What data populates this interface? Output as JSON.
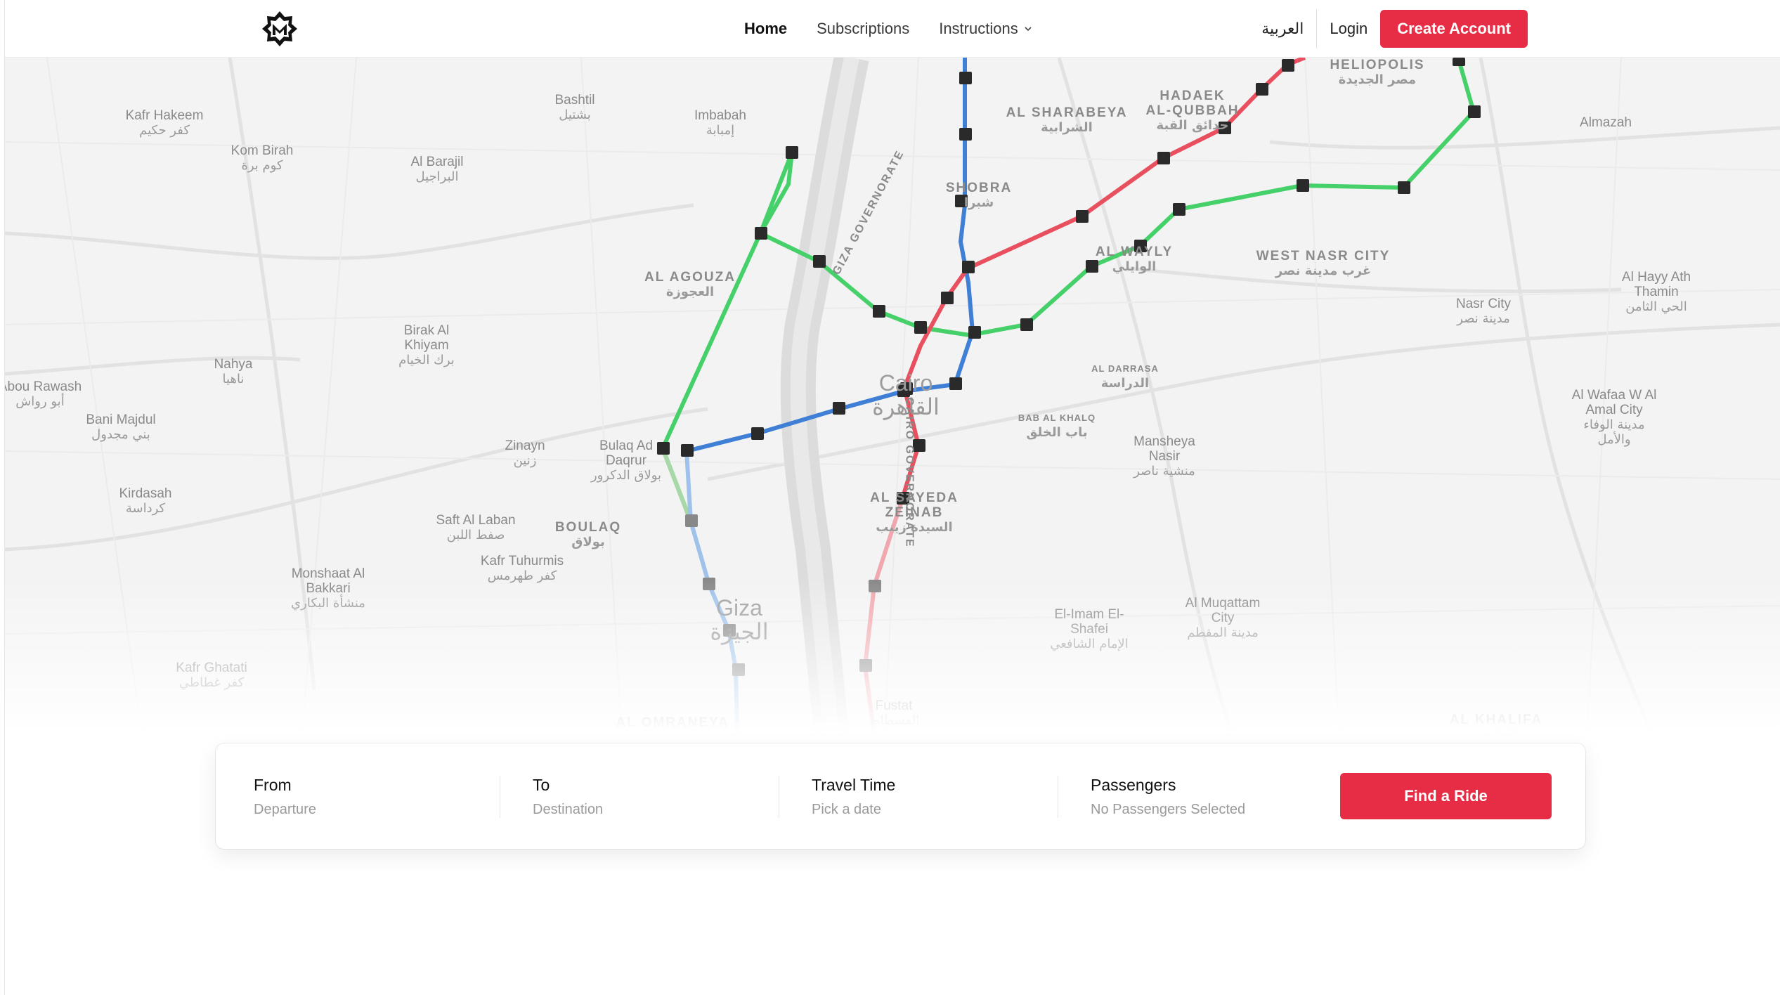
{
  "nav": {
    "links": [
      {
        "label": "Home"
      },
      {
        "label": "Subscriptions"
      },
      {
        "label": "Instructions"
      }
    ],
    "language": "العربية",
    "login": "Login",
    "create_account": "Create Account"
  },
  "map": {
    "places": [
      {
        "en": "Kafr Hakeem",
        "ar": "كفر حكيم"
      },
      {
        "en": "Kom Birah",
        "ar": "كوم برة"
      },
      {
        "en": "Bashtil",
        "ar": "بشتيل"
      },
      {
        "en": "Imbabah",
        "ar": "إمبابة"
      },
      {
        "en": "Al Barajil",
        "ar": "البراجيل"
      },
      {
        "en": "AL SHARABEYA",
        "ar": "الشرابية"
      },
      {
        "en": "HADAEK",
        "ar": ""
      },
      {
        "en": "AL-QUBBAH",
        "ar": "حدائق القبة"
      },
      {
        "en": "HELIOPOLIS",
        "ar": "مصر الجديدة"
      },
      {
        "en": "Almazah",
        "ar": ""
      },
      {
        "en": "SHOBRA",
        "ar": "شبرا"
      },
      {
        "en": "AL AGOUZA",
        "ar": "العجوزة"
      },
      {
        "en": "AL WAYLY",
        "ar": "الوايلي"
      },
      {
        "en": "WEST NASR CITY",
        "ar": "غرب مدينة نصر"
      },
      {
        "en": "Nasr City",
        "ar": "مدينة نصر"
      },
      {
        "en": "Al Hayy Ath Thamin",
        "ar": "الحي الثامن"
      },
      {
        "en": "Birak Al Khiyam",
        "ar": "برك الخيام"
      },
      {
        "en": "Nahya",
        "ar": "ناهيا"
      },
      {
        "en": "Abou Rawash",
        "ar": "أبو رواش"
      },
      {
        "en": "Bani Majdul",
        "ar": "بني مجدول"
      },
      {
        "en": "Cairo",
        "ar": "القاهرة"
      },
      {
        "en": "AL DARRASA",
        "ar": "الدراسة"
      },
      {
        "en": "BAB AL KHALQ",
        "ar": "باب الخلق"
      },
      {
        "en": "Zinayn",
        "ar": "زنين"
      },
      {
        "en": "Bulaq Ad Daqrur",
        "ar": "بولاق الدكرور"
      },
      {
        "en": "Mansheya Nasir",
        "ar": "منشية ناصر"
      },
      {
        "en": "Al Wafaa W Al Amal City",
        "ar": "مدينة الوفاء والأمل"
      },
      {
        "en": "Kirdasah",
        "ar": "كرداسة"
      },
      {
        "en": "Saft Al Laban",
        "ar": "صفط اللبن"
      },
      {
        "en": "BOULAQ",
        "ar": "بولاق"
      },
      {
        "en": "Kafr Tuhurmis",
        "ar": "كفر طهرمس"
      },
      {
        "en": "AL SAYEDA ZEINAB",
        "ar": "السيدة زينب"
      },
      {
        "en": "Monshaat Al Bakkari",
        "ar": "منشأة البكاري"
      },
      {
        "en": "Giza",
        "ar": "الجيزة"
      },
      {
        "en": "El-Imam El-Shafei",
        "ar": "الإمام الشافعي"
      },
      {
        "en": "Al Muqattam City",
        "ar": "مدينة المقطم"
      },
      {
        "en": "Kafr Ghatati",
        "ar": "كفر غطاطي"
      },
      {
        "en": "AL OMRANEYA",
        "ar": ""
      },
      {
        "en": "Fustat",
        "ar": "الفسطاط"
      },
      {
        "en": "AL KHALIFA",
        "ar": "الخليفة"
      },
      {
        "en": "GIZA GOVERNORATE",
        "ar": ""
      },
      {
        "en": "CAIRO GOVERNORATE",
        "ar": ""
      }
    ],
    "station_marker": "M",
    "line_colors": {
      "line1": "#e9505f",
      "line2": "#3f7fd6",
      "line3": "#45d06a"
    }
  },
  "search": {
    "from": {
      "label": "From",
      "value": "Departure"
    },
    "to": {
      "label": "To",
      "value": "Destination"
    },
    "time": {
      "label": "Travel Time",
      "value": "Pick a date"
    },
    "passengers": {
      "label": "Passengers",
      "value": "No Passengers Selected"
    },
    "button": "Find a Ride"
  },
  "colors": {
    "accent": "#e62d45"
  }
}
